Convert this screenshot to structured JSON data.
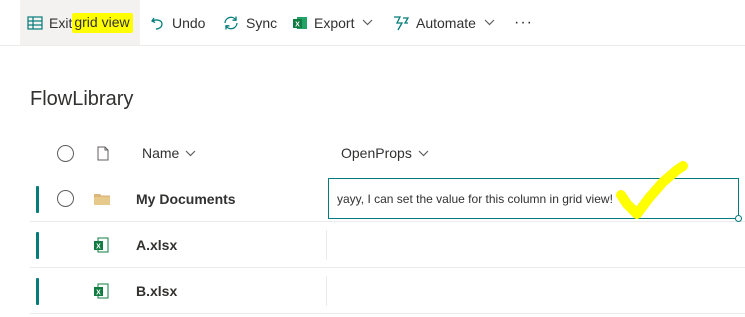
{
  "toolbar": {
    "exit_prefix": "Exit ",
    "exit_highlight": "grid view",
    "undo": "Undo",
    "sync": "Sync",
    "export": "Export",
    "automate": "Automate",
    "more": "···"
  },
  "library": {
    "title": "FlowLibrary"
  },
  "columns": {
    "name": "Name",
    "openprops": "OpenProps"
  },
  "rows": [
    {
      "name": "My Documents",
      "type": "folder",
      "openprops": "yayy, I can set the value for this column in grid view!"
    },
    {
      "name": "A.xlsx",
      "type": "excel",
      "openprops": ""
    },
    {
      "name": "B.xlsx",
      "type": "excel",
      "openprops": ""
    }
  ],
  "colors": {
    "accent": "#037c7a",
    "highlight": "#ffff00",
    "excel": "#107c41",
    "folder": "#dcb67a"
  }
}
